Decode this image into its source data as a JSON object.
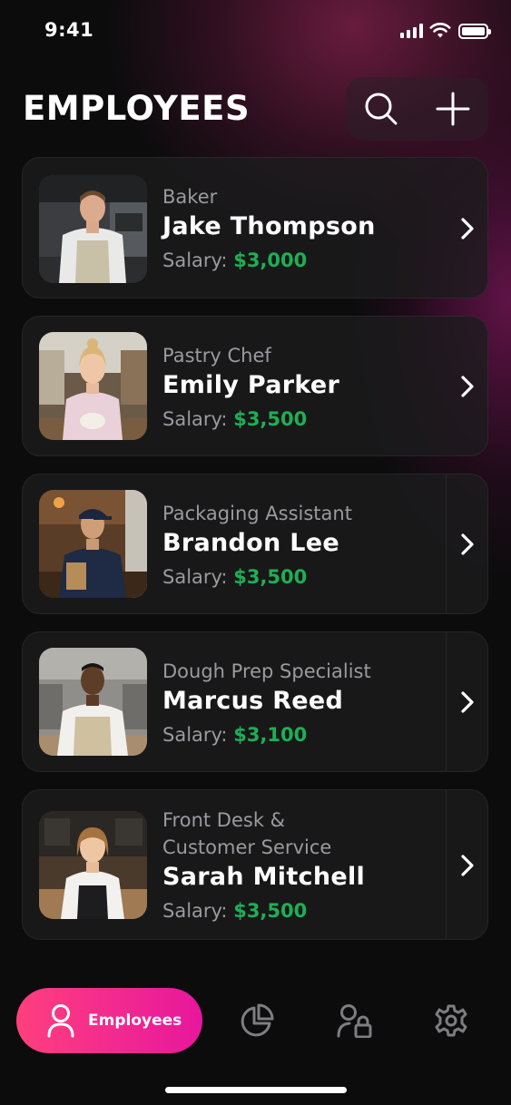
{
  "status_bar": {
    "time": "9:41"
  },
  "header": {
    "title": "EMPLOYEES"
  },
  "employees": [
    {
      "role": "Baker",
      "name": "Jake Thompson",
      "salary_label": "Salary:",
      "salary": "$3,000"
    },
    {
      "role": "Pastry Chef",
      "name": "Emily Parker",
      "salary_label": "Salary:",
      "salary": "$3,500"
    },
    {
      "role": "Packaging Assistant",
      "name": "Brandon Lee",
      "salary_label": "Salary:",
      "salary": "$3,500"
    },
    {
      "role": "Dough Prep Specialist",
      "name": "Marcus Reed",
      "salary_label": "Salary:",
      "salary": "$3,100"
    },
    {
      "role": "Front Desk &",
      "role_line2": "Customer Service",
      "name": "Sarah Mitchell",
      "salary_label": "Salary:",
      "salary": "$3,500"
    }
  ],
  "bottom_nav": {
    "active_label": "Employees",
    "items": [
      "employees",
      "analytics",
      "access-management",
      "settings"
    ]
  },
  "colors": {
    "accent_start": "#ff3f7d",
    "accent_end": "#e7179e",
    "salary": "#1fae55"
  }
}
